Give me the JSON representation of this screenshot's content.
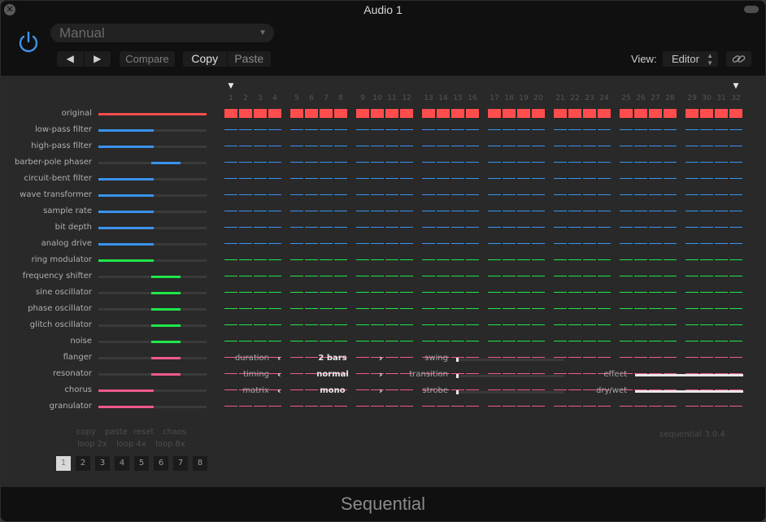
{
  "window": {
    "title": "Audio 1",
    "close_icon": "close-x-icon"
  },
  "header": {
    "power_icon": "power-icon",
    "power_color": "#3f94e8",
    "preset": "Manual",
    "prev_icon": "◀",
    "next_icon": "▶",
    "compare": "Compare",
    "copy": "Copy",
    "paste": "Paste",
    "view_label": "View:",
    "view_value": "Editor",
    "link_icon": "link-icon"
  },
  "colors": {
    "red": "#ff4d4d",
    "blue": "#3a93ee",
    "green": "#1fe64a",
    "pink": "#f05a8a",
    "track": "#3a3a3a"
  },
  "steps": [
    "1",
    "2",
    "3",
    "4",
    "5",
    "6",
    "7",
    "8",
    "9",
    "10",
    "11",
    "12",
    "13",
    "14",
    "15",
    "16",
    "17",
    "18",
    "19",
    "20",
    "21",
    "22",
    "23",
    "24",
    "25",
    "26",
    "27",
    "28",
    "29",
    "30",
    "31",
    "32"
  ],
  "playhead": {
    "start_step": 1,
    "end_step": 32
  },
  "effects": [
    {
      "name": "original",
      "color": "red",
      "range": [
        0,
        1.0
      ],
      "active_steps": "all"
    },
    {
      "name": "low-pass filter",
      "color": "blue",
      "range": [
        0,
        0.51
      ],
      "active_steps": "none"
    },
    {
      "name": "high-pass filter",
      "color": "blue",
      "range": [
        0,
        0.51
      ],
      "active_steps": "none"
    },
    {
      "name": "barber-pole phaser",
      "color": "blue",
      "range": [
        0.49,
        0.76
      ],
      "active_steps": "none"
    },
    {
      "name": "circuit-bent filter",
      "color": "blue",
      "range": [
        0,
        0.51
      ],
      "active_steps": "none"
    },
    {
      "name": "wave transformer",
      "color": "blue",
      "range": [
        0,
        0.51
      ],
      "active_steps": "none"
    },
    {
      "name": "sample rate",
      "color": "blue",
      "range": [
        0,
        0.51
      ],
      "active_steps": "none"
    },
    {
      "name": "bit depth",
      "color": "blue",
      "range": [
        0,
        0.51
      ],
      "active_steps": "none"
    },
    {
      "name": "analog drive",
      "color": "blue",
      "range": [
        0,
        0.51
      ],
      "active_steps": "none"
    },
    {
      "name": "ring modulator",
      "color": "green",
      "range": [
        0,
        0.51
      ],
      "active_steps": "none"
    },
    {
      "name": "frequency shifter",
      "color": "green",
      "range": [
        0.49,
        0.76
      ],
      "active_steps": "none"
    },
    {
      "name": "sine oscillator",
      "color": "green",
      "range": [
        0.49,
        0.76
      ],
      "active_steps": "none"
    },
    {
      "name": "phase oscillator",
      "color": "green",
      "range": [
        0.49,
        0.76
      ],
      "active_steps": "none"
    },
    {
      "name": "glitch oscillator",
      "color": "green",
      "range": [
        0.49,
        0.76
      ],
      "active_steps": "none"
    },
    {
      "name": "noise",
      "color": "green",
      "range": [
        0.49,
        0.76
      ],
      "active_steps": "none"
    },
    {
      "name": "flanger",
      "color": "pink",
      "range": [
        0.49,
        0.76
      ],
      "active_steps": "none"
    },
    {
      "name": "resonator",
      "color": "pink",
      "range": [
        0.49,
        0.76
      ],
      "active_steps": "none"
    },
    {
      "name": "chorus",
      "color": "pink",
      "range": [
        0,
        0.51
      ],
      "active_steps": "none"
    },
    {
      "name": "granulator",
      "color": "pink",
      "range": [
        0,
        0.51
      ],
      "active_steps": "none"
    }
  ],
  "actions": {
    "row1": [
      "copy",
      "paste",
      "reset",
      "chaos"
    ],
    "row2": [
      "loop 2x",
      "loop 4x",
      "loop 8x"
    ]
  },
  "patterns": {
    "items": [
      "1",
      "2",
      "3",
      "4",
      "5",
      "6",
      "7",
      "8"
    ],
    "selected": "1"
  },
  "controls": {
    "duration": {
      "label": "duration",
      "value": "2 bars"
    },
    "timing": {
      "label": "timing",
      "value": "normal"
    },
    "matrix": {
      "label": "matrix",
      "value": "mono"
    },
    "prev_icon": "‹",
    "next_icon": "›"
  },
  "sliders": {
    "swing": {
      "label": "swing",
      "value": 0
    },
    "transition": {
      "label": "transition",
      "value": 0
    },
    "strobe": {
      "label": "strobe",
      "value": 0
    }
  },
  "mix": {
    "version": "sequential 3.0.4",
    "effect": {
      "label": "effect",
      "value": 1.0
    },
    "drywet": {
      "label": "dry/wet",
      "value": 1.0
    }
  },
  "footer": {
    "title": "Sequential"
  }
}
